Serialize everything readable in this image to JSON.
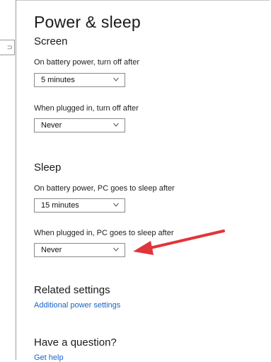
{
  "page": {
    "title": "Power & sleep"
  },
  "screen": {
    "heading": "Screen",
    "battery_label": "On battery power, turn off after",
    "battery_value": "5 minutes",
    "plugged_label": "When plugged in, turn off after",
    "plugged_value": "Never"
  },
  "sleep": {
    "heading": "Sleep",
    "battery_label": "On battery power, PC goes to sleep after",
    "battery_value": "15 minutes",
    "plugged_label": "When plugged in, PC goes to sleep after",
    "plugged_value": "Never"
  },
  "related": {
    "heading": "Related settings",
    "link": "Additional power settings"
  },
  "question": {
    "heading": "Have a question?",
    "link": "Get help"
  },
  "colors": {
    "link": "#1a64c6",
    "annotation_arrow": "#e0353a"
  },
  "icons": [
    "chevron-down-icon",
    "annotation-arrow-icon"
  ]
}
